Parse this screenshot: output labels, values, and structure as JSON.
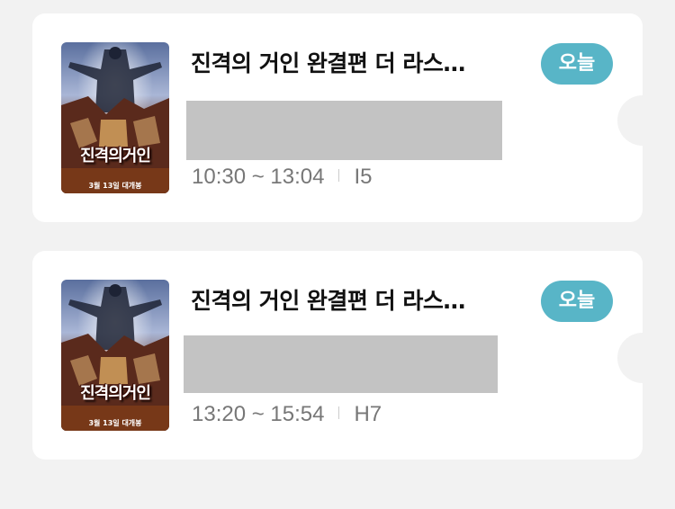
{
  "tickets": [
    {
      "title": "진격의 거인 완결편 더 라스…",
      "badge": "오늘",
      "time": "10:30 ~ 13:04",
      "seat": "I5",
      "poster": {
        "title": "진격의거인",
        "subtitle": "3월 13일 대개봉"
      }
    },
    {
      "title": "진격의 거인 완결편 더 라스…",
      "badge": "오늘",
      "time": "13:20 ~ 15:54",
      "seat": "H7",
      "poster": {
        "title": "진격의거인",
        "subtitle": "3월 13일 대개봉"
      }
    }
  ],
  "colors": {
    "badge": "#58b5c7",
    "background": "#f2f2f2",
    "card": "#ffffff",
    "redaction": "#c3c3c3"
  }
}
